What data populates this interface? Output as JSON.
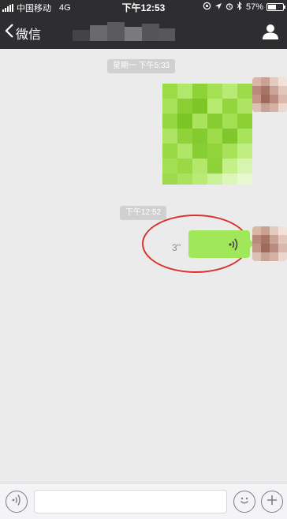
{
  "status_bar": {
    "carrier": "中国移动",
    "network": "4G",
    "time": "下午12:53",
    "battery": "57%",
    "battery_level": 0.57
  },
  "nav": {
    "back_label": "微信"
  },
  "chat": {
    "timestamps": [
      "星期一 下午5:33",
      "下午12:52"
    ],
    "voice_duration": "3''"
  },
  "colors": {
    "bar_bg": "#2e2e31",
    "bubble_green": "#a0e759",
    "annotation_red": "#d9302c",
    "chat_bg": "#ebebeb"
  },
  "icons": {
    "back": "chevron-left-icon",
    "profile": "person-icon",
    "voice_wave": "voice-wave-icon",
    "voice_input": "voice-input-icon",
    "emoji": "emoji-icon",
    "plus": "plus-icon"
  }
}
